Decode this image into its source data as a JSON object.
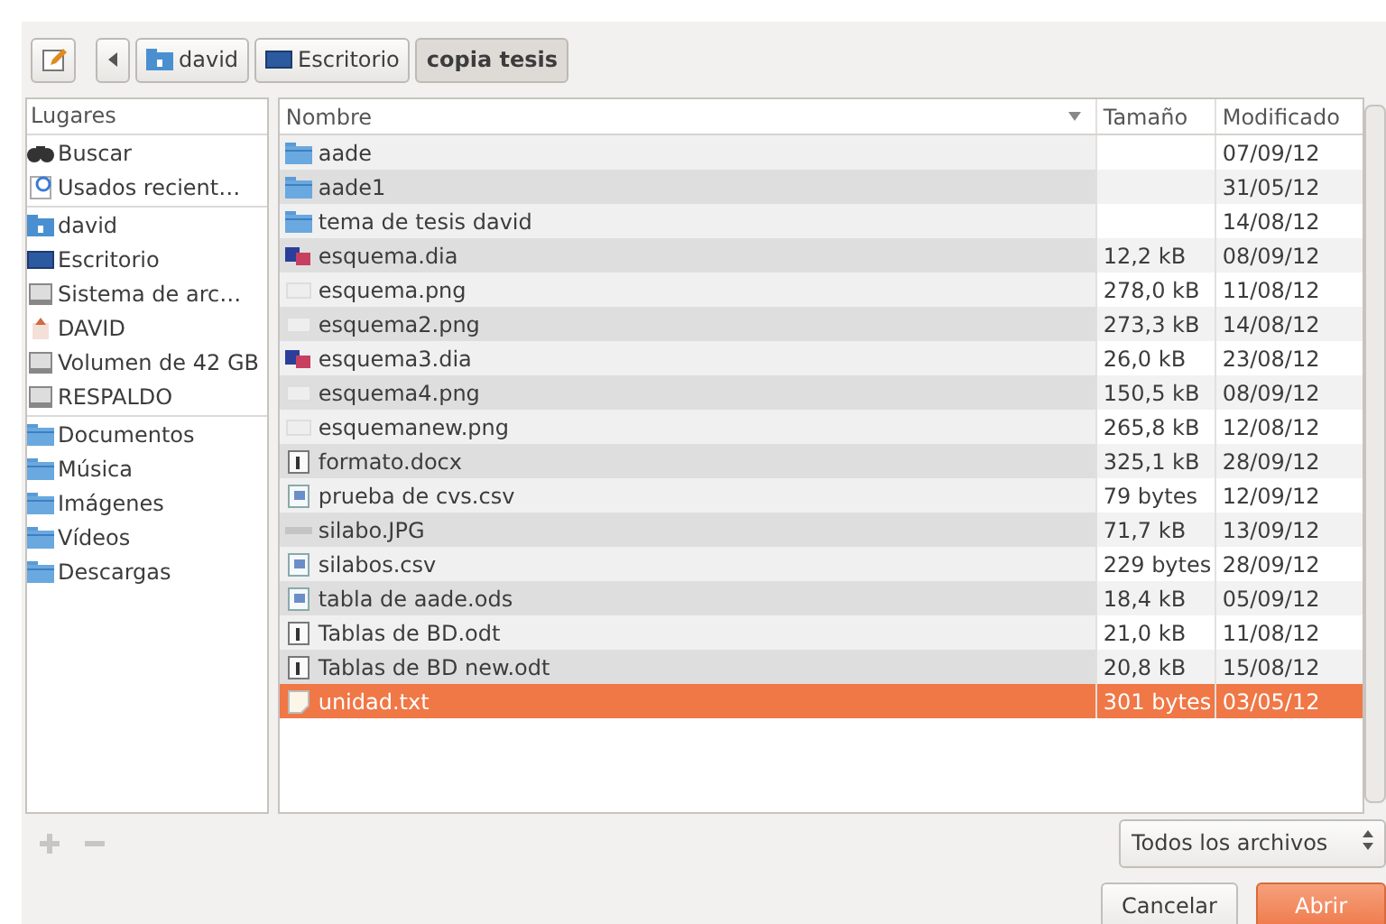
{
  "path_bar": [
    {
      "label": "david",
      "kind": "home",
      "selected": false
    },
    {
      "label": "Escritorio",
      "kind": "desktop",
      "selected": false
    },
    {
      "label": "copia tesis",
      "kind": "none",
      "selected": true
    }
  ],
  "places": {
    "title": "Lugares",
    "sections": [
      [
        {
          "label": "Buscar",
          "kind": "search"
        },
        {
          "label": "Usados recient…",
          "kind": "recent"
        }
      ],
      [
        {
          "label": "david",
          "kind": "home"
        },
        {
          "label": "Escritorio",
          "kind": "desktop"
        },
        {
          "label": "Sistema de arc…",
          "kind": "drive"
        },
        {
          "label": "DAVID",
          "kind": "usb"
        },
        {
          "label": "Volumen de 42 GB",
          "kind": "drive"
        },
        {
          "label": "RESPALDO",
          "kind": "drive"
        }
      ],
      [
        {
          "label": "Documentos",
          "kind": "folder"
        },
        {
          "label": "Música",
          "kind": "folder"
        },
        {
          "label": "Imágenes",
          "kind": "folder"
        },
        {
          "label": "Vídeos",
          "kind": "folder"
        },
        {
          "label": "Descargas",
          "kind": "folder"
        }
      ]
    ]
  },
  "files": {
    "columns": [
      "Nombre",
      "Tamaño",
      "Modificado"
    ],
    "rows": [
      {
        "name": "aade",
        "kind": "folder",
        "size": "",
        "modified": "07/09/12",
        "selected": false
      },
      {
        "name": "aade1",
        "kind": "folder",
        "size": "",
        "modified": "31/05/12",
        "selected": false
      },
      {
        "name": "tema de tesis david",
        "kind": "folder",
        "size": "",
        "modified": "14/08/12",
        "selected": false
      },
      {
        "name": "esquema.dia",
        "kind": "diagram",
        "size": "12,2 kB",
        "modified": "08/09/12",
        "selected": false
      },
      {
        "name": "esquema.png",
        "kind": "image",
        "size": "278,0 kB",
        "modified": "11/08/12",
        "selected": false
      },
      {
        "name": "esquema2.png",
        "kind": "image",
        "size": "273,3 kB",
        "modified": "14/08/12",
        "selected": false
      },
      {
        "name": "esquema3.dia",
        "kind": "diagram",
        "size": "26,0 kB",
        "modified": "23/08/12",
        "selected": false
      },
      {
        "name": "esquema4.png",
        "kind": "image",
        "size": "150,5 kB",
        "modified": "08/09/12",
        "selected": false
      },
      {
        "name": "esquemanew.png",
        "kind": "image",
        "size": "265,8 kB",
        "modified": "12/08/12",
        "selected": false
      },
      {
        "name": "formato.docx",
        "kind": "document",
        "size": "325,1 kB",
        "modified": "28/09/12",
        "selected": false
      },
      {
        "name": "prueba de cvs.csv",
        "kind": "sheet",
        "size": "79 bytes",
        "modified": "12/09/12",
        "selected": false
      },
      {
        "name": "silabo.JPG",
        "kind": "photo",
        "size": "71,7 kB",
        "modified": "13/09/12",
        "selected": false
      },
      {
        "name": "silabos.csv",
        "kind": "sheet",
        "size": "229 bytes",
        "modified": "28/09/12",
        "selected": false
      },
      {
        "name": "tabla de aade.ods",
        "kind": "sheet",
        "size": "18,4 kB",
        "modified": "05/09/12",
        "selected": false
      },
      {
        "name": "Tablas de BD.odt",
        "kind": "document",
        "size": "21,0 kB",
        "modified": "11/08/12",
        "selected": false
      },
      {
        "name": "Tablas de BD new.odt",
        "kind": "document",
        "size": "20,8 kB",
        "modified": "15/08/12",
        "selected": false
      },
      {
        "name": "unidad.txt",
        "kind": "text",
        "size": "301 bytes",
        "modified": "03/05/12",
        "selected": true
      }
    ]
  },
  "filter": {
    "value": "Todos los archivos"
  },
  "buttons": [
    {
      "label": "Cancelar",
      "kind": "normal"
    },
    {
      "label": "Abrir",
      "kind": "default"
    }
  ]
}
